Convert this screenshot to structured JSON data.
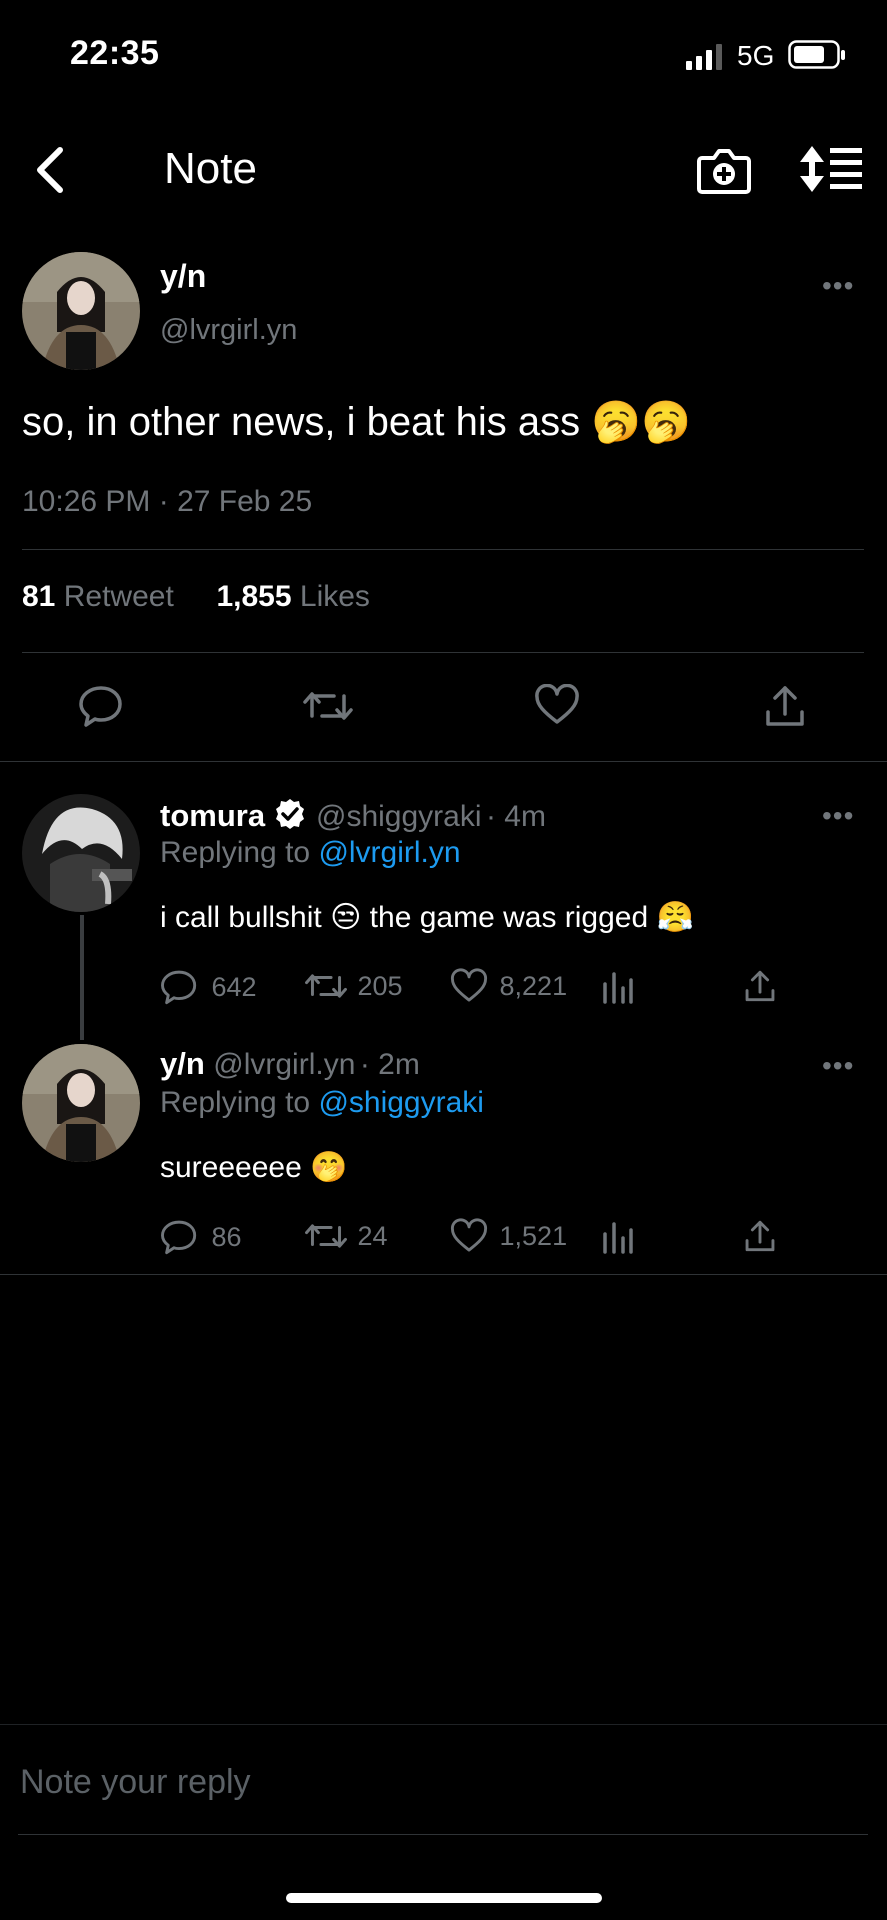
{
  "status_bar": {
    "time": "22:35",
    "network": "5G"
  },
  "nav": {
    "title": "Note"
  },
  "main_tweet": {
    "name": "y/n",
    "handle": "@lvrgirl.yn",
    "text": "so, in other news, i beat his ass 🥱🥱",
    "timestamp": "10:26 PM · 27 Feb 25",
    "retweets_count": "81",
    "retweets_label": "Retweet",
    "likes_count": "1,855",
    "likes_label": "Likes"
  },
  "replies": [
    {
      "name": "tomura",
      "handle": "@shiggyraki",
      "time": "· 4m",
      "replying_label": "Replying to",
      "replying_to": "@lvrgirl.yn",
      "text": "i call bullshit 😒  the game was rigged 😤",
      "comments": "642",
      "retweets": "205",
      "likes": "8,221"
    },
    {
      "name": "y/n",
      "handle": "@lvrgirl.yn",
      "time": "· 2m",
      "replying_label": "Replying to",
      "replying_to": "@shiggyraki",
      "text": "sureeeeee 🤭",
      "comments": "86",
      "retweets": "24",
      "likes": "1,521"
    }
  ],
  "composer": {
    "placeholder": "Note your reply"
  }
}
